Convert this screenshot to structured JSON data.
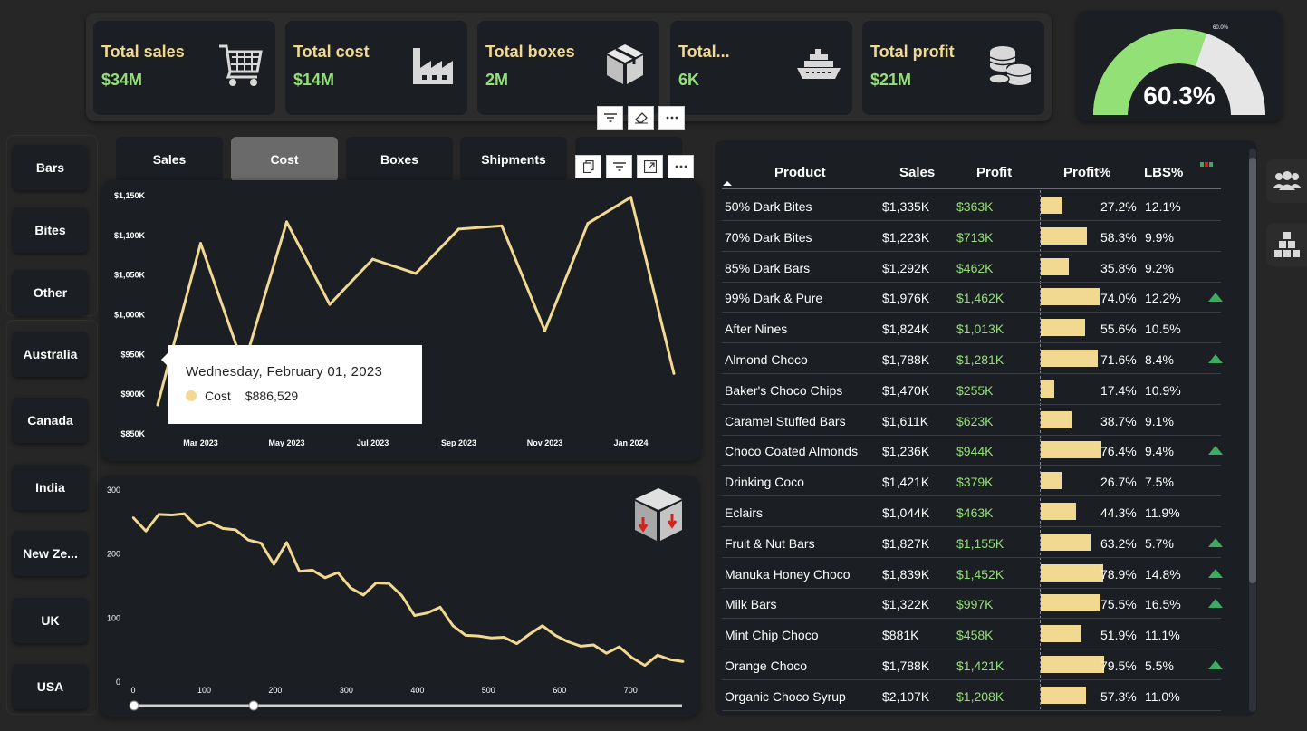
{
  "kpis": [
    {
      "label": "Total sales",
      "value": "$34M",
      "icon": "shopping-cart-icon"
    },
    {
      "label": "Total cost",
      "value": "$14M",
      "icon": "factory-icon"
    },
    {
      "label": "Total boxes",
      "value": "2M",
      "icon": "box-icon"
    },
    {
      "label": "Total...",
      "value": "6K",
      "icon": "ship-icon"
    },
    {
      "label": "Total profit",
      "value": "$21M",
      "icon": "coins-icon"
    }
  ],
  "gauge": {
    "value_label": "60.3%",
    "target_label": "60.0%",
    "fraction": 0.603,
    "fill_color": "#93e076",
    "track_color": "#e6e6e6"
  },
  "slicers": {
    "categories": [
      "Bars",
      "Bites",
      "Other"
    ],
    "countries": [
      "Australia",
      "Canada",
      "India",
      "New Ze...",
      "UK",
      "USA"
    ]
  },
  "tabs": [
    {
      "label": "Sales",
      "active": false
    },
    {
      "label": "Cost",
      "active": true
    },
    {
      "label": "Boxes",
      "active": false
    },
    {
      "label": "Shipments",
      "active": false
    }
  ],
  "tooltip": {
    "title": "Wednesday, February 01, 2023",
    "series": "Cost",
    "value": "$886,529"
  },
  "table": {
    "headers": {
      "product": "Product",
      "sales": "Sales",
      "profit": "Profit",
      "profit_pct": "Profit%",
      "lbs": "LBS%"
    },
    "rows": [
      {
        "product": "50% Dark Bites",
        "sales": "$1,335K",
        "profit": "$363K",
        "pct": "27.2%",
        "pct_value": 27.2,
        "lbs": "12.1%",
        "up": false
      },
      {
        "product": "70% Dark Bites",
        "sales": "$1,223K",
        "profit": "$713K",
        "pct": "58.3%",
        "pct_value": 58.3,
        "lbs": "9.9%",
        "up": false
      },
      {
        "product": "85% Dark Bars",
        "sales": "$1,292K",
        "profit": "$462K",
        "pct": "35.8%",
        "pct_value": 35.8,
        "lbs": "9.2%",
        "up": false
      },
      {
        "product": "99% Dark & Pure",
        "sales": "$1,976K",
        "profit": "$1,462K",
        "pct": "74.0%",
        "pct_value": 74.0,
        "lbs": "12.2%",
        "up": true
      },
      {
        "product": "After Nines",
        "sales": "$1,824K",
        "profit": "$1,013K",
        "pct": "55.6%",
        "pct_value": 55.6,
        "lbs": "10.5%",
        "up": false
      },
      {
        "product": "Almond Choco",
        "sales": "$1,788K",
        "profit": "$1,281K",
        "pct": "71.6%",
        "pct_value": 71.6,
        "lbs": "8.4%",
        "up": true
      },
      {
        "product": "Baker's Choco Chips",
        "sales": "$1,470K",
        "profit": "$255K",
        "pct": "17.4%",
        "pct_value": 17.4,
        "lbs": "10.9%",
        "up": false
      },
      {
        "product": "Caramel Stuffed Bars",
        "sales": "$1,611K",
        "profit": "$623K",
        "pct": "38.7%",
        "pct_value": 38.7,
        "lbs": "9.1%",
        "up": false
      },
      {
        "product": "Choco Coated Almonds",
        "sales": "$1,236K",
        "profit": "$944K",
        "pct": "76.4%",
        "pct_value": 76.4,
        "lbs": "9.4%",
        "up": true
      },
      {
        "product": "Drinking Coco",
        "sales": "$1,421K",
        "profit": "$379K",
        "pct": "26.7%",
        "pct_value": 26.7,
        "lbs": "7.5%",
        "up": false
      },
      {
        "product": "Eclairs",
        "sales": "$1,044K",
        "profit": "$463K",
        "pct": "44.3%",
        "pct_value": 44.3,
        "lbs": "11.9%",
        "up": false
      },
      {
        "product": "Fruit & Nut Bars",
        "sales": "$1,827K",
        "profit": "$1,155K",
        "pct": "63.2%",
        "pct_value": 63.2,
        "lbs": "5.7%",
        "up": true
      },
      {
        "product": "Manuka Honey Choco",
        "sales": "$1,839K",
        "profit": "$1,452K",
        "pct": "78.9%",
        "pct_value": 78.9,
        "lbs": "14.8%",
        "up": true
      },
      {
        "product": "Milk Bars",
        "sales": "$1,322K",
        "profit": "$997K",
        "pct": "75.5%",
        "pct_value": 75.5,
        "lbs": "16.5%",
        "up": true
      },
      {
        "product": "Mint Chip Choco",
        "sales": "$881K",
        "profit": "$458K",
        "pct": "51.9%",
        "pct_value": 51.9,
        "lbs": "11.1%",
        "up": false
      },
      {
        "product": "Orange Choco",
        "sales": "$1,788K",
        "profit": "$1,421K",
        "pct": "79.5%",
        "pct_value": 79.5,
        "lbs": "5.5%",
        "up": true
      },
      {
        "product": "Organic Choco Syrup",
        "sales": "$2,107K",
        "profit": "$1,208K",
        "pct": "57.3%",
        "pct_value": 57.3,
        "lbs": "11.0%",
        "up": false
      }
    ]
  },
  "colors": {
    "accent_yellow": "#f1d991",
    "accent_green": "#93e076",
    "up_arrow": "#3fa861",
    "card_bg": "#1b1e22"
  },
  "chart_data": [
    {
      "type": "line",
      "series": [
        {
          "name": "Cost",
          "values": [
            886529,
            1090000,
            935000,
            1117000,
            1013000,
            1070000,
            1052000,
            1108000,
            1112000,
            980000,
            1115000,
            1148000,
            926000
          ]
        }
      ],
      "x": [
        "Feb 2023",
        "Mar 2023",
        "Apr 2023",
        "May 2023",
        "Jun 2023",
        "Jul 2023",
        "Aug 2023",
        "Sep 2023",
        "Oct 2023",
        "Nov 2023",
        "Dec 2023",
        "Jan 2024",
        "Feb 2024"
      ],
      "x_ticks": [
        "Mar 2023",
        "May 2023",
        "Jul 2023",
        "Sep 2023",
        "Nov 2023",
        "Jan 2024"
      ],
      "y_ticks": [
        "$850K",
        "$900K",
        "$950K",
        "$1,000K",
        "$1,050K",
        "$1,100K",
        "$1,150K"
      ],
      "ylim": [
        850000,
        1150000
      ],
      "color": "#f1d991"
    },
    {
      "type": "line",
      "series": [
        {
          "values": [
            257,
            236,
            262,
            261,
            263,
            243,
            250,
            240,
            238,
            222,
            217,
            184,
            218,
            173,
            175,
            163,
            171,
            147,
            136,
            155,
            154,
            135,
            104,
            108,
            117,
            88,
            73,
            72,
            69,
            70,
            60,
            75,
            88,
            73,
            63,
            56,
            58,
            45,
            55,
            38,
            26,
            42,
            35,
            32
          ]
        }
      ],
      "x_start": 0,
      "x_step": 18,
      "x_ticks": [
        "0",
        "100",
        "200",
        "300",
        "400",
        "500",
        "600",
        "700"
      ],
      "y_ticks": [
        "0",
        "100",
        "200",
        "300"
      ],
      "xlim": [
        0,
        780
      ],
      "ylim": [
        0,
        300
      ],
      "color": "#f1d991"
    }
  ]
}
